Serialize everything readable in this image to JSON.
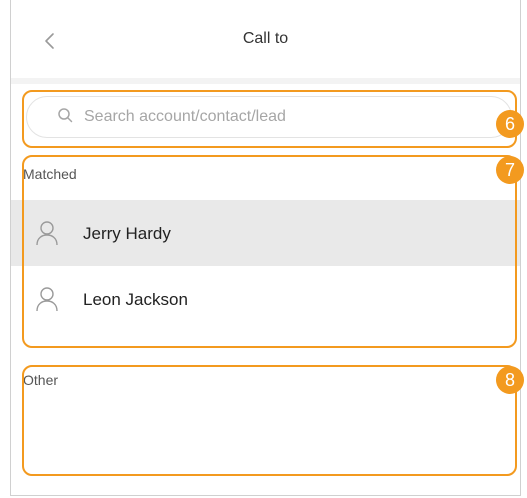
{
  "header": {
    "title": "Call to",
    "back_icon": "chevron-left-icon"
  },
  "search": {
    "placeholder": "Search account/contact/lead",
    "value": "",
    "icon": "search-icon"
  },
  "matched": {
    "label": "Matched",
    "items": [
      {
        "name": "Jerry Hardy",
        "icon": "person-icon",
        "selected": true
      },
      {
        "name": "Leon Jackson",
        "icon": "person-icon",
        "selected": false
      }
    ]
  },
  "other": {
    "label": "Other"
  },
  "annotations": [
    {
      "number": "6"
    },
    {
      "number": "7"
    },
    {
      "number": "8"
    }
  ],
  "colors": {
    "annotation": "#f39a1f",
    "selected_row": "#e9e9e9",
    "divider": "#f3f3f3"
  }
}
